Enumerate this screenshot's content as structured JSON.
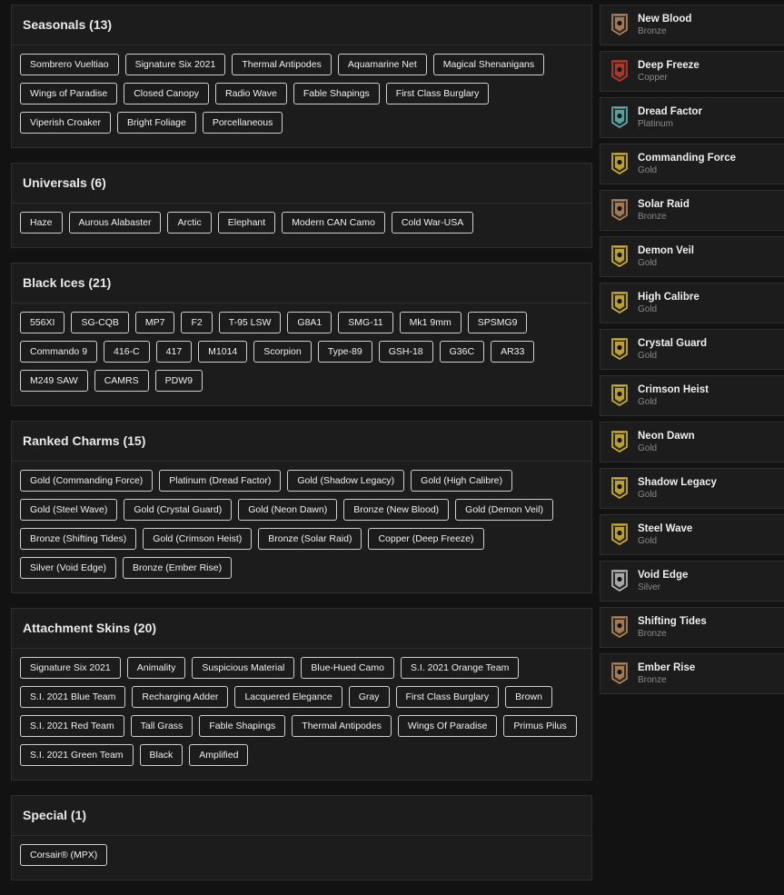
{
  "sections": [
    {
      "title": "Seasonals (13)",
      "items": [
        "Sombrero Vueltiao",
        "Signature Six 2021",
        "Thermal Antipodes",
        "Aquamarine Net",
        "Magical Shenanigans",
        "Wings of Paradise",
        "Closed Canopy",
        "Radio Wave",
        "Fable Shapings",
        "First Class Burglary",
        "Viperish Croaker",
        "Bright Foliage",
        "Porcellaneous"
      ]
    },
    {
      "title": "Universals (6)",
      "items": [
        "Haze",
        "Aurous Alabaster",
        "Arctic",
        "Elephant",
        "Modern CAN Camo",
        "Cold War-USA"
      ]
    },
    {
      "title": "Black Ices (21)",
      "items": [
        "556XI",
        "SG-CQB",
        "MP7",
        "F2",
        "T-95 LSW",
        "G8A1",
        "SMG-11",
        "Mk1 9mm",
        "SPSMG9",
        "Commando 9",
        "416-C",
        "417",
        "M1014",
        "Scorpion",
        "Type-89",
        "GSH-18",
        "G36C",
        "AR33",
        "M249 SAW",
        "CAMRS",
        "PDW9"
      ]
    },
    {
      "title": "Ranked Charms (15)",
      "items": [
        "Gold (Commanding Force)",
        "Platinum (Dread Factor)",
        "Gold (Shadow Legacy)",
        "Gold (High Calibre)",
        "Gold (Steel Wave)",
        "Gold (Crystal Guard)",
        "Gold (Neon Dawn)",
        "Bronze (New Blood)",
        "Gold (Demon Veil)",
        "Bronze (Shifting Tides)",
        "Gold (Crimson Heist)",
        "Bronze (Solar Raid)",
        "Copper (Deep Freeze)",
        "Silver (Void Edge)",
        "Bronze (Ember Rise)"
      ]
    },
    {
      "title": "Attachment Skins (20)",
      "items": [
        "Signature Six 2021",
        "Animality",
        "Suspicious Material",
        "Blue-Hued Camo",
        "S.I. 2021 Orange Team",
        "S.I. 2021 Blue Team",
        "Recharging Adder",
        "Lacquered Elegance",
        "Gray",
        "First Class Burglary",
        "Brown",
        "S.I. 2021 Red Team",
        "Tall Grass",
        "Fable Shapings",
        "Thermal Antipodes",
        "Wings Of Paradise",
        "Primus Pilus",
        "S.I. 2021 Green Team",
        "Black",
        "Amplified"
      ]
    },
    {
      "title": "Special (1)",
      "items": [
        "Corsair® (MPX)"
      ]
    }
  ],
  "charms": [
    {
      "name": "New Blood",
      "tier": "Bronze",
      "color": "#b8875a"
    },
    {
      "name": "Deep Freeze",
      "tier": "Copper",
      "color": "#c0392b"
    },
    {
      "name": "Dread Factor",
      "tier": "Platinum",
      "color": "#5fb6b0"
    },
    {
      "name": "Commanding Force",
      "tier": "Gold",
      "color": "#d4b437"
    },
    {
      "name": "Solar Raid",
      "tier": "Bronze",
      "color": "#b8875a"
    },
    {
      "name": "Demon Veil",
      "tier": "Gold",
      "color": "#d4b437"
    },
    {
      "name": "High Calibre",
      "tier": "Gold",
      "color": "#d4b437"
    },
    {
      "name": "Crystal Guard",
      "tier": "Gold",
      "color": "#d4b437"
    },
    {
      "name": "Crimson Heist",
      "tier": "Gold",
      "color": "#d4b437"
    },
    {
      "name": "Neon Dawn",
      "tier": "Gold",
      "color": "#d4b437"
    },
    {
      "name": "Shadow Legacy",
      "tier": "Gold",
      "color": "#d4b437"
    },
    {
      "name": "Steel Wave",
      "tier": "Gold",
      "color": "#d4b437"
    },
    {
      "name": "Void Edge",
      "tier": "Silver",
      "color": "#bdbdbd"
    },
    {
      "name": "Shifting Tides",
      "tier": "Bronze",
      "color": "#b8875a"
    },
    {
      "name": "Ember Rise",
      "tier": "Bronze",
      "color": "#b8875a"
    }
  ],
  "colors": {
    "background": "#121212",
    "panel": "#1c1c1c",
    "border": "#2e2e2e",
    "chip_border": "#cfcfcf",
    "subtext": "#8a8a8a"
  },
  "icons": {
    "charm": "rank-badge-icon"
  }
}
